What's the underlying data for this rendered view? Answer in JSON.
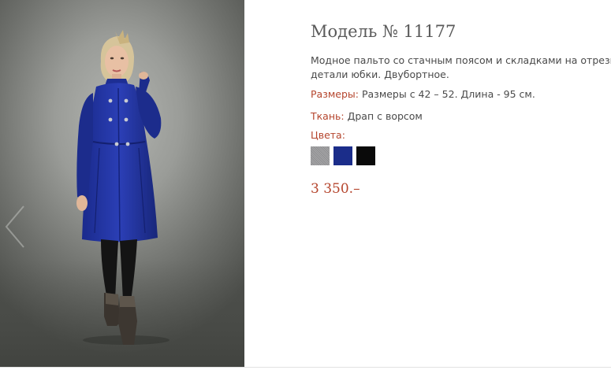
{
  "product": {
    "title": "Модель № 11177",
    "description_lines": [
      "Модное пальто со стачным поясом и складками на отрезной",
      "детали юбки. Двубортное."
    ],
    "sizes": {
      "label": "Размеры:",
      "value": "Размеры с 42 – 52. Длина - 95 см."
    },
    "fabric": {
      "label": "Ткань:",
      "value": "Драп с ворсом"
    },
    "colors_label": "Цвета:",
    "colors": [
      {
        "name": "grey",
        "hex": "#9c9c9e"
      },
      {
        "name": "blue",
        "hex": "#1b2d8a"
      },
      {
        "name": "black",
        "hex": "#0a0a0a"
      }
    ],
    "price": "3 350.–"
  },
  "gallery": {
    "prev_icon": "chevron-left-icon",
    "photo_subject": "woman in royal blue double-breasted coat"
  }
}
